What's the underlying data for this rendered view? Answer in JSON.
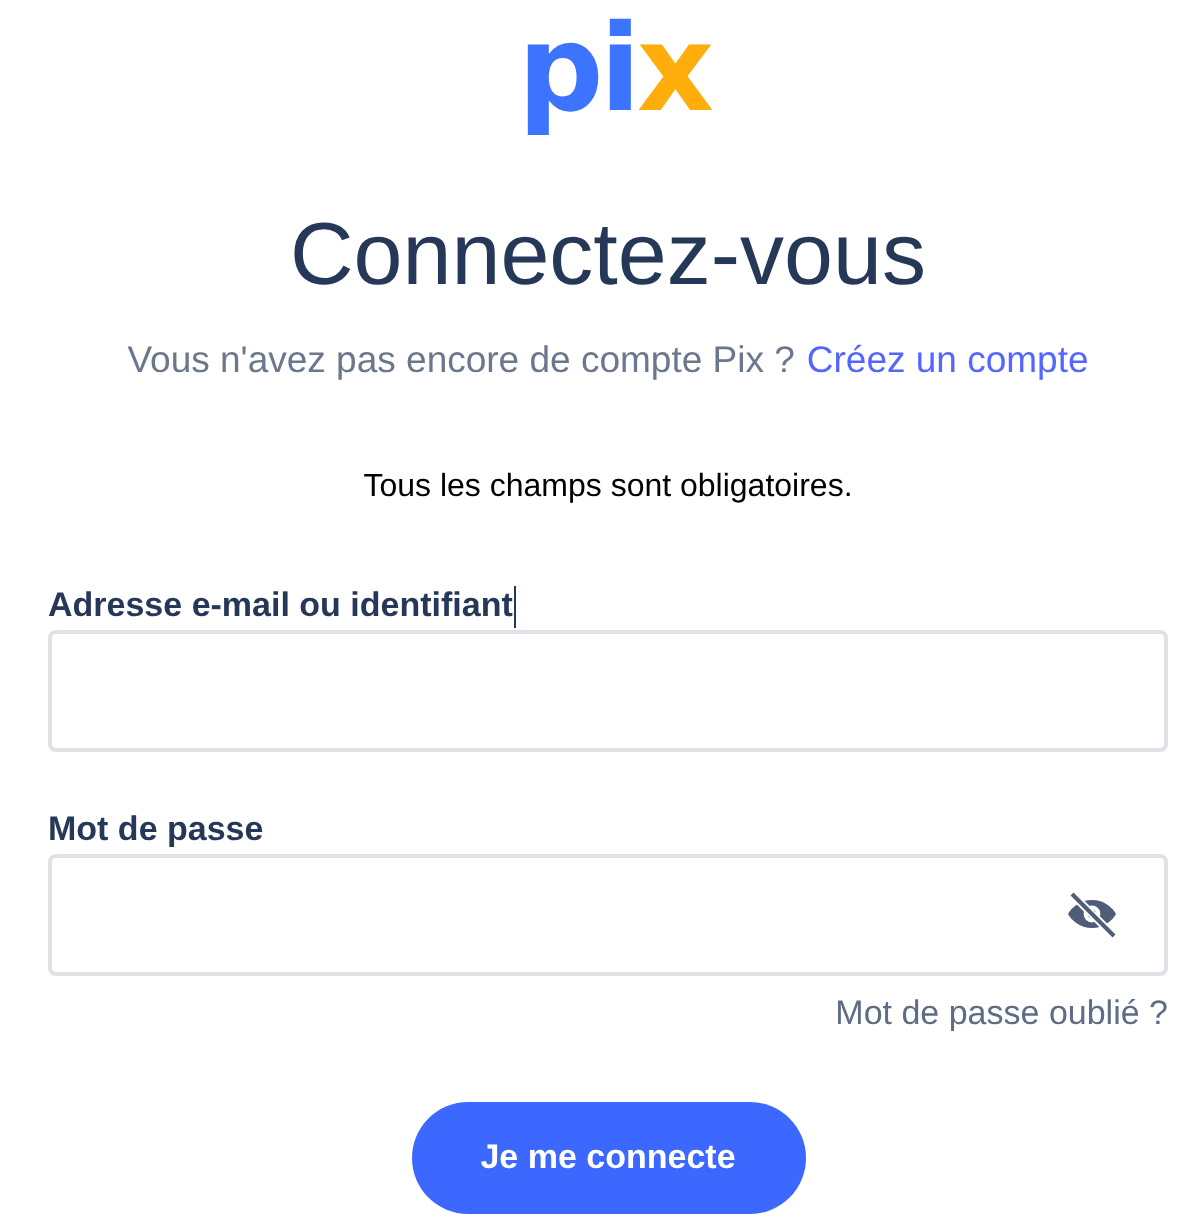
{
  "logo": {
    "parts": [
      {
        "text": "pi",
        "color": "#3d74ff"
      },
      {
        "text": "x",
        "color": "#ffad0a"
      }
    ]
  },
  "title": "Connectez-vous",
  "subtitle": {
    "text": "Vous n'avez pas encore de compte Pix ?",
    "link": "Créez un compte"
  },
  "notice": "Tous les champs sont obligatoires.",
  "fields": [
    {
      "kind": "text",
      "label": "Adresse e-mail ou identifiant",
      "cursor": true
    },
    {
      "kind": "password",
      "label": "Mot de passe",
      "cursor": false,
      "password_visible": false
    }
  ],
  "forgot_link": "Mot de passe oublié ?",
  "submit": "Je me connecte"
}
